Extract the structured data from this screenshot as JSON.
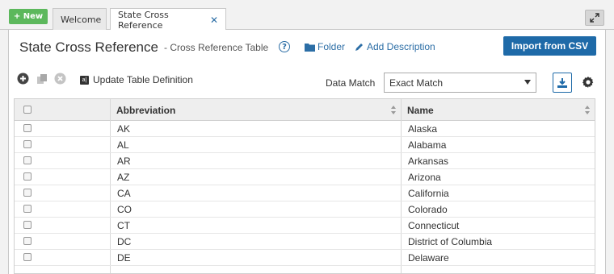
{
  "tabs": {
    "new_label": "+ New",
    "welcome_label": "Welcome",
    "active_label": "State Cross Reference",
    "close_glyph": "✕"
  },
  "header": {
    "title": "State Cross Reference",
    "subtitle": "- Cross Reference Table",
    "help_glyph": "?",
    "folder_label": "Folder",
    "add_description_label": "Add Description",
    "import_label": "Import from CSV"
  },
  "toolbar": {
    "update_def_label": "Update Table Definition",
    "update_def_badge": "a|",
    "data_match_label": "Data Match",
    "data_match_value": "Exact Match"
  },
  "grid": {
    "columns": [
      "Abbreviation",
      "Name"
    ],
    "rows": [
      {
        "abbr": "AK",
        "name": "Alaska"
      },
      {
        "abbr": "AL",
        "name": "Alabama"
      },
      {
        "abbr": "AR",
        "name": "Arkansas"
      },
      {
        "abbr": "AZ",
        "name": "Arizona"
      },
      {
        "abbr": "CA",
        "name": "California"
      },
      {
        "abbr": "CO",
        "name": "Colorado"
      },
      {
        "abbr": "CT",
        "name": "Connecticut"
      },
      {
        "abbr": "DC",
        "name": "District of Columbia"
      },
      {
        "abbr": "DE",
        "name": "Delaware"
      }
    ]
  },
  "colors": {
    "accent": "#1e6aa8",
    "new_button": "#5cb85c",
    "link": "#2c6ea6"
  },
  "icons": [
    "plus-circle-icon",
    "copy-icon",
    "delete-circle-icon",
    "folder-icon",
    "pencil-icon",
    "download-icon",
    "gear-icon",
    "expand-icon",
    "sort-icon",
    "help-icon"
  ]
}
